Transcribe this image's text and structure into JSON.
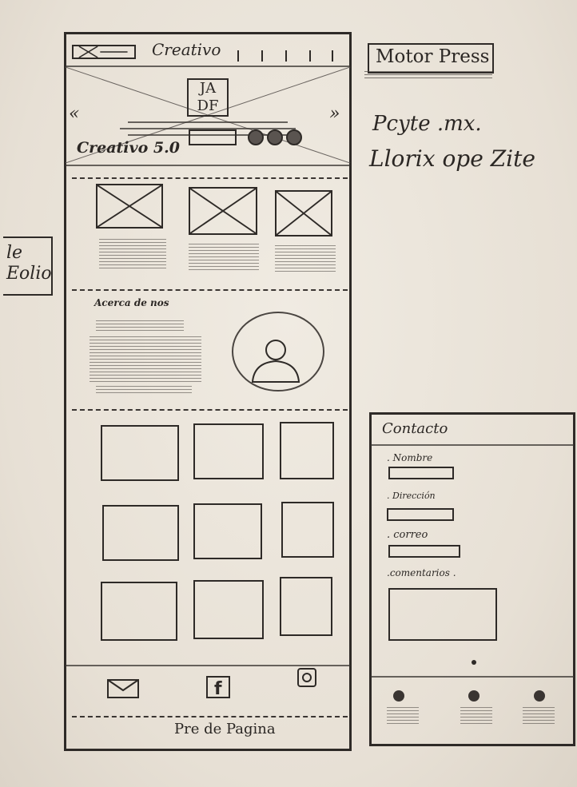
{
  "brand_badge": "Motor Press",
  "side_notes": [
    "Pcyte .mx.",
    "Llorix ope Zite"
  ],
  "left_stub": [
    "le",
    "Eolio"
  ],
  "mobile": {
    "header_title": "Creativo",
    "logo_text": [
      "JA",
      "DF"
    ],
    "carousel_prev": "«",
    "carousel_next": "»",
    "hero_label": "Creativo 5.0",
    "about_label": "Acerca de nos",
    "footer_text": "Pre de Pagina"
  },
  "contact": {
    "title": "Contacto",
    "fields": [
      {
        "label": ". Nombre"
      },
      {
        "label": ". Dirección"
      },
      {
        "label": ". correo"
      },
      {
        "label": ".comentarios ."
      }
    ]
  },
  "icons": [
    "mail-icon",
    "facebook-icon",
    "instagram-icon",
    "image-placeholder-icon",
    "user-silhouette-icon"
  ]
}
